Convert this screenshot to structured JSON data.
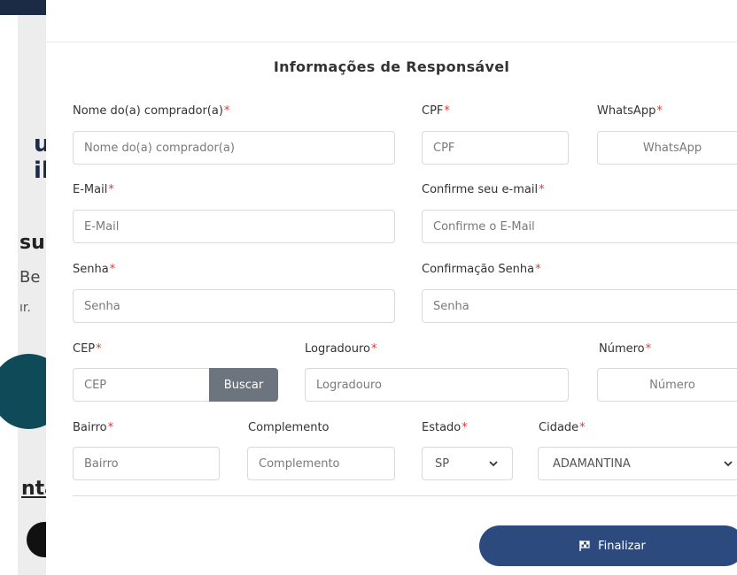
{
  "backdrop": {
    "line1": "ur",
    "line2": "ilír",
    "line3": "su",
    "line4": "Be",
    "line5": "ır.",
    "line6": "nta"
  },
  "form": {
    "title": "Informações de Responsável",
    "required_mark": "*",
    "fields": {
      "nome": {
        "label": "Nome do(a) comprador(a)",
        "placeholder": "Nome do(a) comprador(a)"
      },
      "cpf": {
        "label": "CPF",
        "placeholder": "CPF"
      },
      "whatsapp": {
        "label": "WhatsApp",
        "placeholder": "WhatsApp"
      },
      "email": {
        "label": "E-Mail",
        "placeholder": "E-Mail"
      },
      "confirm_email": {
        "label": "Confirme seu e-mail",
        "placeholder": "Confirme o E-Mail"
      },
      "senha": {
        "label": "Senha",
        "placeholder": "Senha"
      },
      "confirm_senha": {
        "label": "Confirmação Senha",
        "placeholder": "Senha"
      },
      "cep": {
        "label": "CEP",
        "placeholder": "CEP"
      },
      "logradouro": {
        "label": "Logradouro",
        "placeholder": "Logradouro"
      },
      "numero": {
        "label": "Número",
        "placeholder": "Número"
      },
      "bairro": {
        "label": "Bairro",
        "placeholder": "Bairro"
      },
      "complemento": {
        "label": "Complemento",
        "placeholder": "Complemento"
      },
      "estado": {
        "label": "Estado",
        "value": "SP"
      },
      "cidade": {
        "label": "Cidade",
        "value": "ADAMANTINA"
      }
    },
    "buscar_label": "Buscar",
    "finalizar_label": "Finalizar"
  },
  "icons": {
    "chevron": "chevron-down-icon",
    "flag": "flag-icon"
  },
  "colors": {
    "primary": "#2c4a7e",
    "required": "#e53935",
    "buscar": "#6c757d"
  }
}
